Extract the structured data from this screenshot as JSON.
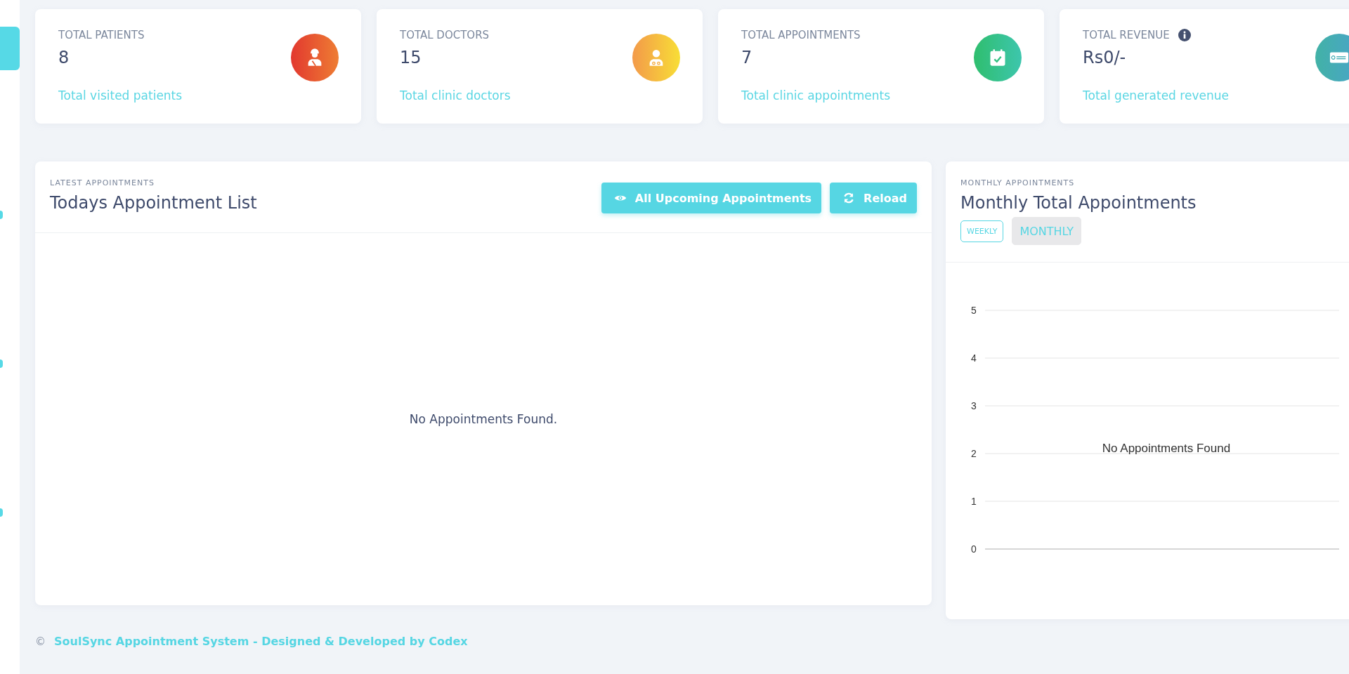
{
  "sidebar": {
    "items": [
      {
        "selected": true
      },
      {
        "selected": false
      },
      {
        "selected": false
      },
      {
        "selected": false
      }
    ]
  },
  "stat_cards": [
    {
      "kind": "patients",
      "label": "TOTAL PATIENTS",
      "value": "8",
      "caption": "Total visited patients",
      "info": false
    },
    {
      "kind": "doctors",
      "label": "TOTAL DOCTORS",
      "value": "15",
      "caption": "Total clinic doctors",
      "info": false
    },
    {
      "kind": "appointments",
      "label": "TOTAL APPOINTMENTS",
      "value": "7",
      "caption": "Total clinic appointments",
      "info": false
    },
    {
      "kind": "revenue",
      "label": "TOTAL REVENUE",
      "value": "Rs0/-",
      "caption": "Total generated revenue",
      "info": true
    }
  ],
  "appointments_panel": {
    "eyebrow": "LATEST APPOINTMENTS",
    "title": "Todays Appointment List",
    "buttons": [
      {
        "kind": "view",
        "label": "All Upcoming Appointments"
      },
      {
        "kind": "reload",
        "label": "Reload"
      }
    ],
    "empty_message": "No Appointments Found."
  },
  "chart_panel": {
    "eyebrow": "MONTHLY APPOINTMENTS",
    "title": "Monthly Total Appointments",
    "tabs": [
      {
        "label": "WEEKLY",
        "selected": false
      },
      {
        "label": "MONTHLY",
        "selected": true
      }
    ],
    "chart": {
      "axis_labels": [
        "5",
        "4",
        "3",
        "2",
        "1",
        "0"
      ],
      "empty_note": "No Appointments Found"
    }
  },
  "footer": {
    "symbol": "©",
    "text": "SoulSync Appointment System - Designed & Developed by Codex"
  }
}
